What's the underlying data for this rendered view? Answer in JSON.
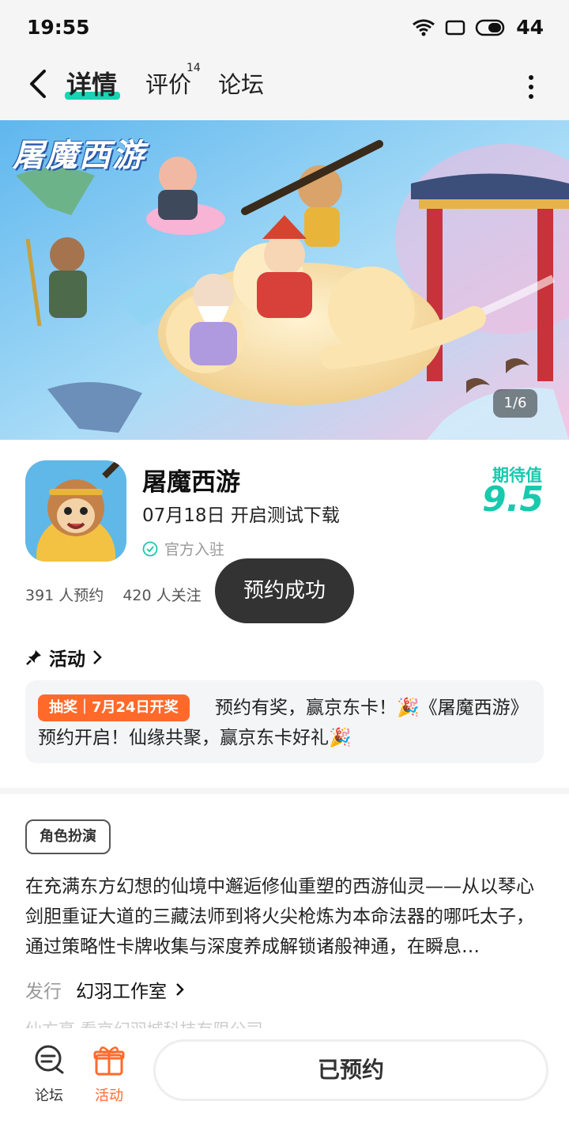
{
  "status_bar": {
    "time": "19:55",
    "battery": "44"
  },
  "nav": {
    "tabs": [
      {
        "label": "详情",
        "active": true
      },
      {
        "label": "评价",
        "badge": "14"
      },
      {
        "label": "论坛"
      }
    ]
  },
  "banner": {
    "logo_text": "屠魔西游",
    "counter": "1/6"
  },
  "app": {
    "name": "屠魔西游",
    "release": "07月18日 开启测试下载",
    "verified": "官方入驻",
    "expect_label": "期待值",
    "expect_score": "9.5",
    "reservations": "391 人预约",
    "followers": "420 人关注"
  },
  "toast": "预约成功",
  "activity": {
    "title": "活动",
    "tag": "抽奖｜7月24日开奖",
    "text": "预约有奖，赢京东卡！🎉《屠魔西游》预约开启！仙缘共聚，赢京东卡好礼🎉"
  },
  "details": {
    "genre": "角色扮演",
    "description": "在充满东方幻想的仙境中邂逅修仙重塑的西游仙灵——从以琴心剑胆重证大道的三藏法师到将火尖枪炼为本命法器的哪吒太子，通过策略性卡牌收集与深度养成解锁诸般神通，在瞬息…",
    "publisher_label": "发行",
    "publisher_name": "幻羽工作室",
    "developer_faded": "仙方亭 看京幻羽城科技有限公司"
  },
  "bottom_bar": {
    "forum_label": "论坛",
    "activity_label": "活动",
    "reserve_label": "已预约"
  },
  "colors": {
    "accent": "#19c9ad",
    "orange": "#ff6a2b",
    "toast_bg": "#333333"
  },
  "icons": [
    "back-arrow-icon",
    "more-vertical-icon",
    "wifi-icon",
    "battery-icon",
    "verified-check-icon",
    "pin-icon",
    "chevron-right-icon",
    "chat-icon",
    "gift-icon"
  ]
}
